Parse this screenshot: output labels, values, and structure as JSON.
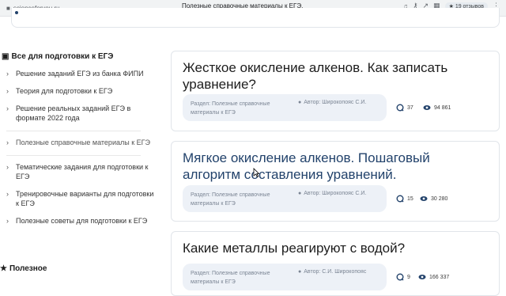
{
  "browser": {
    "url": "scienceforyou.ru",
    "title": "Полезные справочные материалы к ЕГЭ.",
    "reviews": "19 отзывов"
  },
  "sidebar": {
    "title": "Все для подготовки к ЕГЭ",
    "items": [
      {
        "label": "Решение заданий ЕГЭ из банка ФИПИ"
      },
      {
        "label": "Теория для подготовки к ЕГЭ"
      },
      {
        "label": "Решение реальных заданий ЕГЭ в формате 2022 года"
      },
      {
        "label": "Полезные справочные материалы к ЕГЭ"
      },
      {
        "label": "Тематические задания для подготовки к ЕГЭ"
      },
      {
        "label": "Тренировочные варианты для подготовки к ЕГЭ"
      },
      {
        "label": "Полезные советы для подготовки к ЕГЭ"
      }
    ],
    "bottom_title": "Полезное"
  },
  "articles": [
    {
      "title": "Жесткое окисление алкенов. Как записать уравнение?",
      "category": "Раздел: Полезные справочные материалы к ЕГЭ",
      "author": "Автор: Широкопояс С.И.",
      "comments": "37",
      "views": "94 861"
    },
    {
      "title": "Мягкое окисление алкенов. Пошаговый алгоритм составления уравнений.",
      "category": "Раздел: Полезные справочные материалы к ЕГЭ",
      "author": "Автор: Широкопояс С.И.",
      "comments": "15",
      "views": "30 280"
    },
    {
      "title": "Какие металлы реагируют с водой?",
      "category": "Раздел: Полезные справочные материалы к ЕГЭ",
      "author": "Автор: С.И. Широкопояс",
      "comments": "9",
      "views": "166 337"
    }
  ],
  "colors": {
    "accent": "#22426b",
    "meta_bg": "#edf1f7"
  }
}
